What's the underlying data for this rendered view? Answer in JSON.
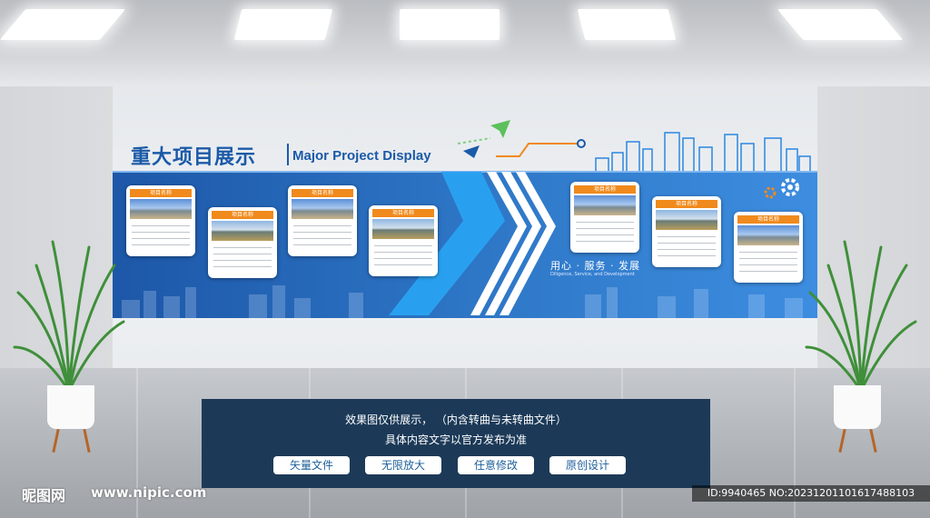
{
  "title": "重大项目展示",
  "subtitle": "Major Project Display",
  "card_label": "项目名称",
  "slogan": "用心 · 服务 · 发展",
  "slogan_en": "Diligence, Service, and Development",
  "info": {
    "line1": "效果图仅供展示， （内含转曲与未转曲文件）",
    "line2": "具体内容文字以官方发布为准",
    "buttons": [
      "矢量文件",
      "无限放大",
      "任意修改",
      "原创设计"
    ]
  },
  "watermark": {
    "logo": "昵图网",
    "site": "www.nipic.com",
    "id": "ID:9940465 NO:20231201101617488103"
  },
  "colors": {
    "board_blue": "#2f78c8",
    "card_header_orange": "#f08a1c",
    "panel_navy": "#1c3a58",
    "title_blue": "#1b5aa8"
  },
  "icons": [
    "gear-icon",
    "paper-plane-icon",
    "city-skyline-icon"
  ]
}
